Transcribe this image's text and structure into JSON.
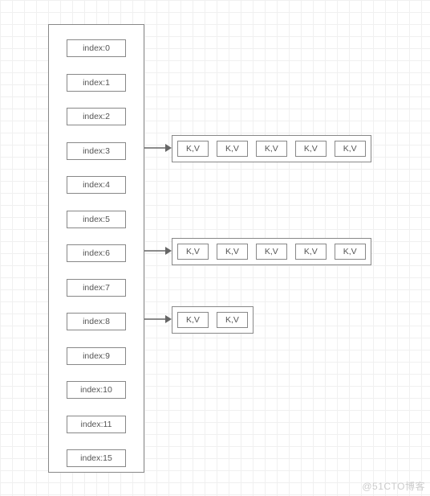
{
  "watermark": "@51CTO博客",
  "indexColumn": {
    "slots": [
      {
        "label": "index:0"
      },
      {
        "label": "index:1"
      },
      {
        "label": "index:2"
      },
      {
        "label": "index:3"
      },
      {
        "label": "index:4"
      },
      {
        "label": "index:5"
      },
      {
        "label": "index:6"
      },
      {
        "label": "index:7"
      },
      {
        "label": "index:8"
      },
      {
        "label": "index:9"
      },
      {
        "label": "index:10"
      },
      {
        "label": "index:11"
      },
      {
        "label": "index:15"
      }
    ]
  },
  "buckets": {
    "b3": {
      "items": [
        {
          "label": "K,V"
        },
        {
          "label": "K,V"
        },
        {
          "label": "K,V"
        },
        {
          "label": "K,V"
        },
        {
          "label": "K,V"
        }
      ]
    },
    "b6": {
      "items": [
        {
          "label": "K,V"
        },
        {
          "label": "K,V"
        },
        {
          "label": "K,V"
        },
        {
          "label": "K,V"
        },
        {
          "label": "K,V"
        }
      ]
    },
    "b8": {
      "items": [
        {
          "label": "K,V"
        },
        {
          "label": "K,V"
        }
      ]
    }
  }
}
